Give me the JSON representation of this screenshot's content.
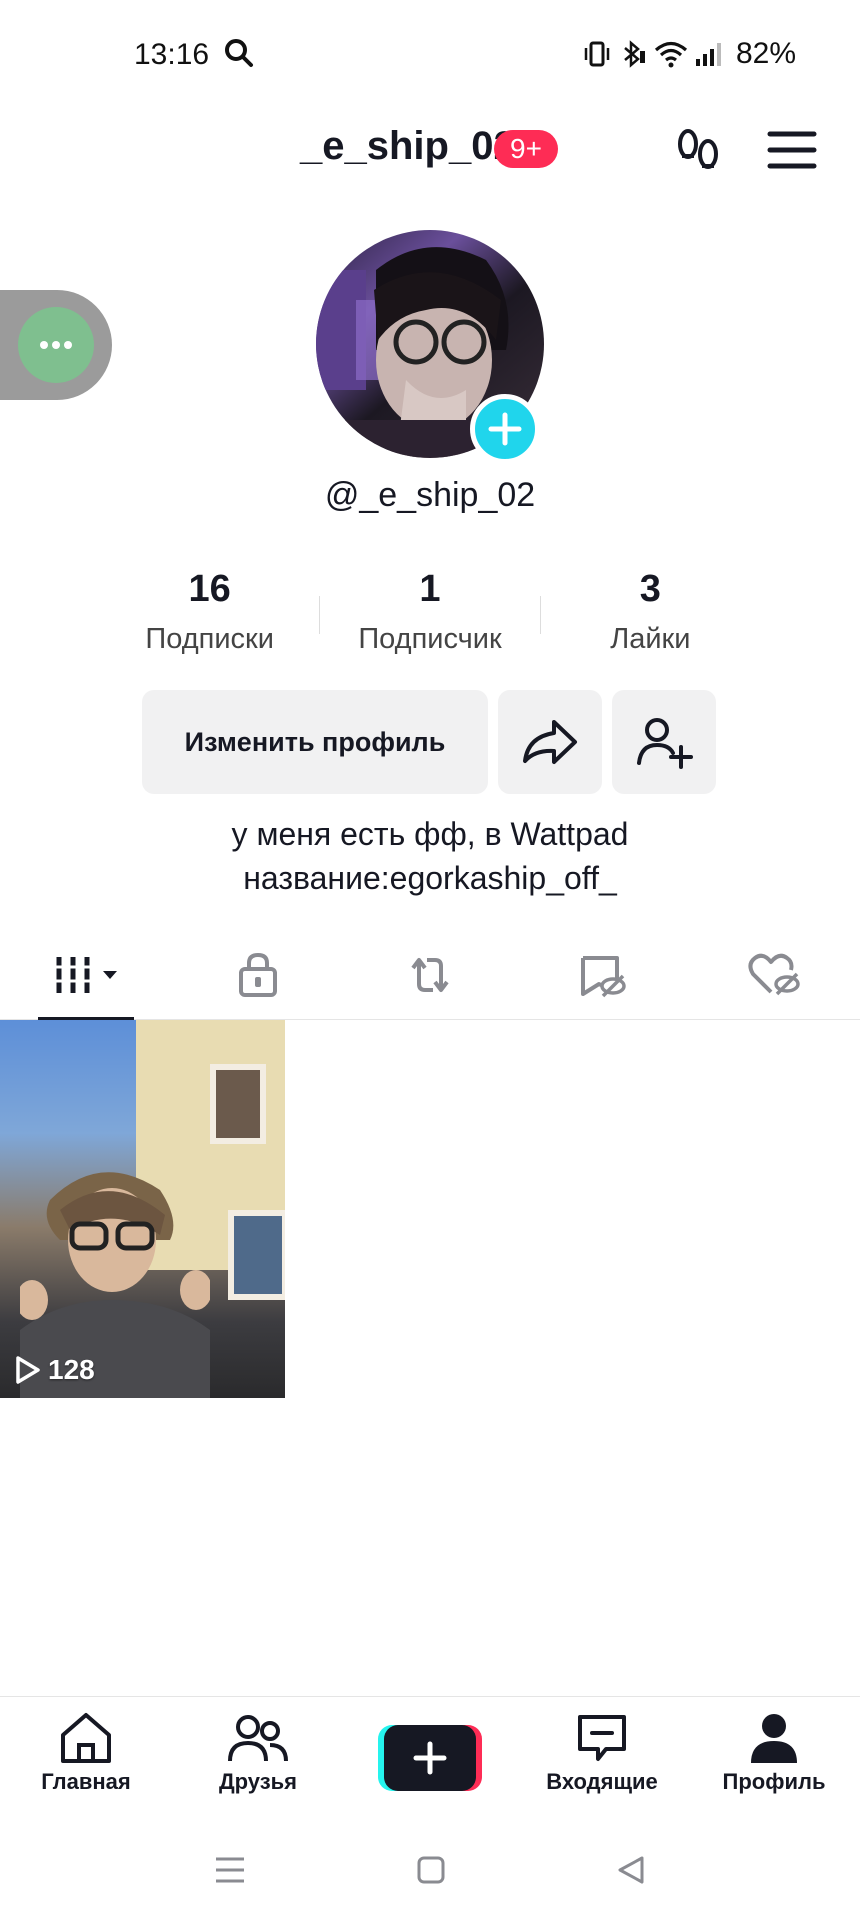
{
  "status_bar": {
    "time": "13:16",
    "battery": "82%"
  },
  "header": {
    "title": "_e_ship_02",
    "badge": "9+"
  },
  "profile": {
    "handle": "@_e_ship_02",
    "stats": [
      {
        "value": "16",
        "label": "Подписки"
      },
      {
        "value": "1",
        "label": "Подписчик"
      },
      {
        "value": "3",
        "label": "Лайки"
      }
    ],
    "edit_button": "Изменить профиль",
    "bio_line1": "у меня есть фф, в Wattpad",
    "bio_line2": "название:egorkaship_off_"
  },
  "tabs": [
    {
      "icon": "videos-grid-icon",
      "active": true
    },
    {
      "icon": "lock-icon",
      "active": false
    },
    {
      "icon": "repost-icon",
      "active": false
    },
    {
      "icon": "bookmark-hidden-icon",
      "active": false
    },
    {
      "icon": "liked-hidden-icon",
      "active": false
    }
  ],
  "videos": [
    {
      "views": "128"
    }
  ],
  "bottom_nav": {
    "home": "Главная",
    "friends": "Друзья",
    "inbox": "Входящие",
    "profile": "Профиль"
  },
  "colors": {
    "accent_red": "#fe2c55",
    "accent_cyan": "#25f4ee",
    "avatar_add": "#20d5ec",
    "text": "#161823"
  }
}
